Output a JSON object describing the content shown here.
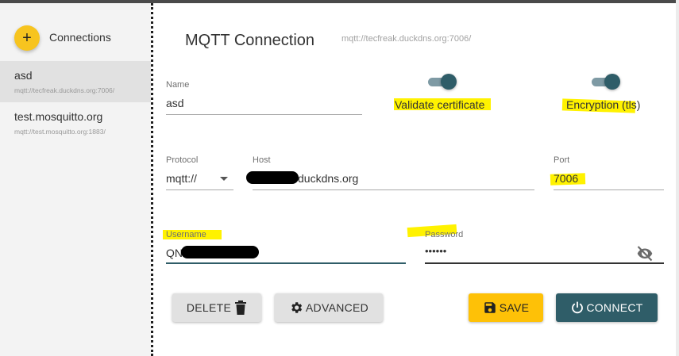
{
  "sidebar": {
    "title": "Connections",
    "add_button_icon": "plus-icon",
    "connections": [
      {
        "name": "asd",
        "url": "mqtt://tecfreak.duckdns.org:7006/",
        "selected": true
      },
      {
        "name": "test.mosquitto.org",
        "url": "mqtt://test.mosquitto.org:1883/",
        "selected": false
      }
    ]
  },
  "main": {
    "title": "MQTT Connection",
    "url": "mqtt://tecfreak.duckdns.org:7006/",
    "name": {
      "label": "Name",
      "value": "asd"
    },
    "validate_certificate": {
      "label": "Validate certificate",
      "checked": true
    },
    "encryption": {
      "label": "Encryption (tls)",
      "checked": true
    },
    "protocol": {
      "label": "Protocol",
      "value": "mqtt://"
    },
    "host": {
      "label": "Host",
      "value": "duckdns.org"
    },
    "port": {
      "label": "Port",
      "value": "7006"
    },
    "username": {
      "label": "Username",
      "value": "QN"
    },
    "password": {
      "label": "Password",
      "value": "••••••",
      "visibility_icon": "eye-off-icon"
    }
  },
  "actions": {
    "delete_label": "DELETE",
    "advanced_label": "ADVANCED",
    "save_label": "SAVE",
    "connect_label": "CONNECT"
  },
  "colors": {
    "accent_yellow": "#fec107",
    "fab_yellow": "#f7c41f",
    "primary_teal": "#2f5d68",
    "toggle_track": "#7e9aa4",
    "highlight": "#fff200"
  }
}
